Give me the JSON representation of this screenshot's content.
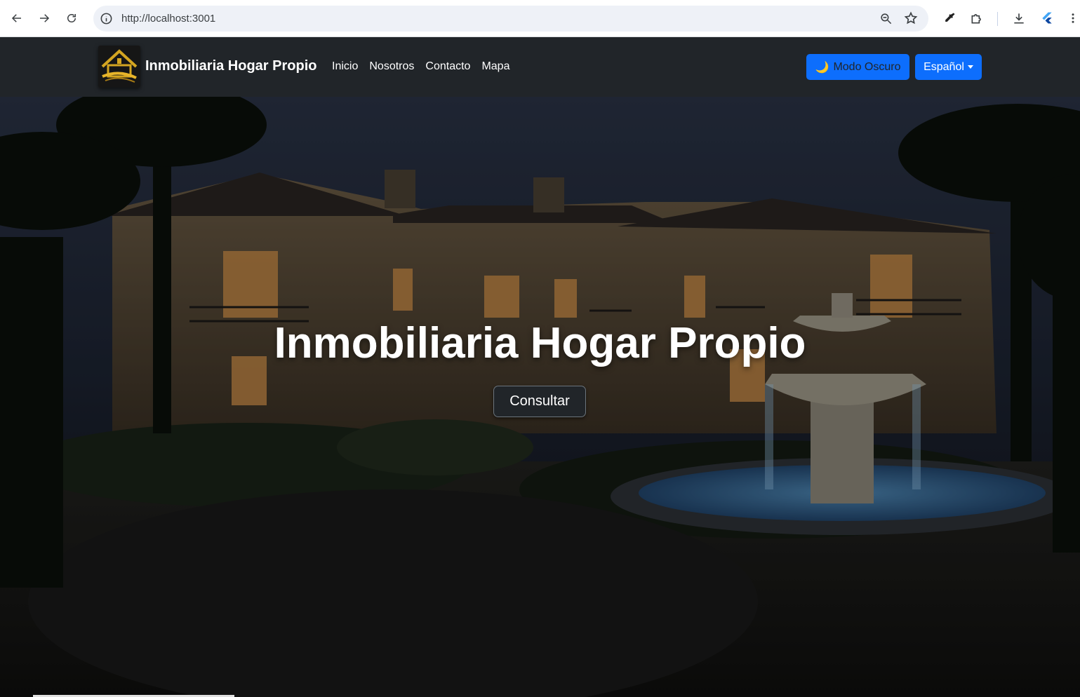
{
  "browser": {
    "url": "http://localhost:3001",
    "icons": [
      "back-icon",
      "forward-icon",
      "reload-icon",
      "info-icon",
      "zoom-icon",
      "star-icon",
      "eyedropper-icon",
      "extensions-icon",
      "download-icon",
      "flutter-icon",
      "menu-icon"
    ]
  },
  "navbar": {
    "brand": "Inmobiliaria Hogar Propio",
    "links": [
      "Inicio",
      "Nosotros",
      "Contacto",
      "Mapa"
    ],
    "dark_mode_icon": "🌙",
    "dark_mode_label": "Modo Oscuro",
    "language_label": "Español",
    "colors": {
      "background": "#212529",
      "button": "#0d6efd"
    }
  },
  "hero": {
    "title": "Inmobiliaria Hogar Propio",
    "cta_label": "Consultar"
  }
}
